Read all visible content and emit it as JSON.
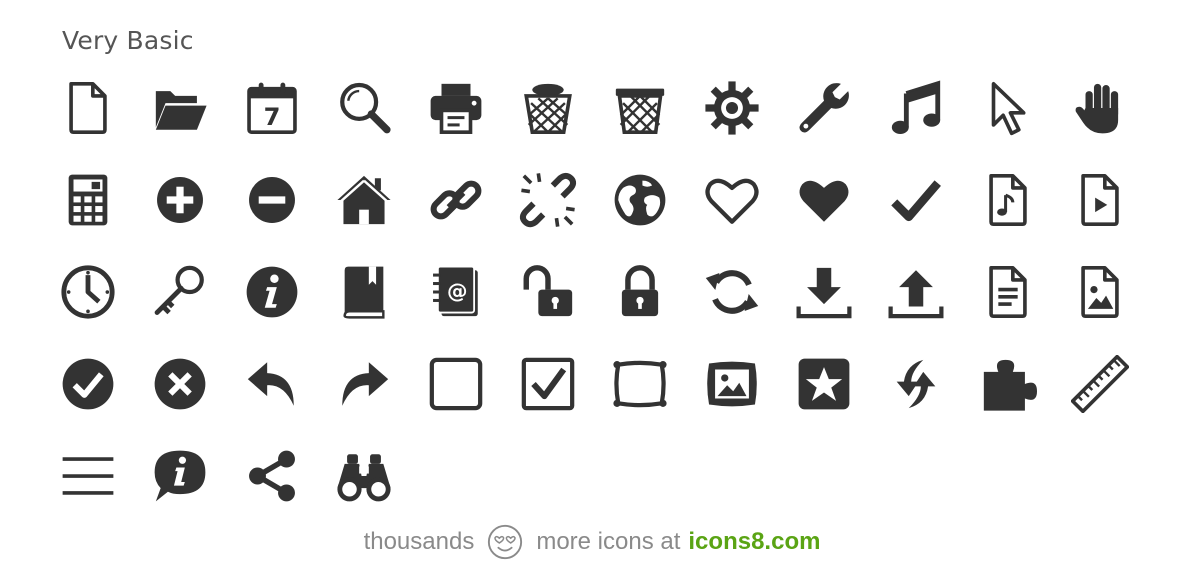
{
  "title": "Very Basic",
  "icons": [
    "document-icon",
    "folder-open-icon",
    "calendar-icon",
    "search-icon",
    "printer-icon",
    "trash-icon",
    "trash-empty-icon",
    "gear-icon",
    "wrench-icon",
    "music-note-icon",
    "cursor-icon",
    "hand-icon",
    "calculator-icon",
    "plus-circle-icon",
    "minus-circle-icon",
    "home-icon",
    "link-icon",
    "unlink-icon",
    "globe-icon",
    "heart-outline-icon",
    "heart-icon",
    "checkmark-icon",
    "audio-file-icon",
    "video-file-icon",
    "clock-icon",
    "key-icon",
    "info-icon",
    "book-icon",
    "address-book-icon",
    "lock-open-icon",
    "lock-icon",
    "refresh-icon",
    "download-icon",
    "upload-icon",
    "text-file-icon",
    "image-file-icon",
    "check-circle-icon",
    "close-circle-icon",
    "reply-icon",
    "forward-icon",
    "checkbox-empty-icon",
    "checkbox-checked-icon",
    "picture-frame-icon",
    "framed-picture-icon",
    "star-square-icon",
    "sync-arrows-icon",
    "puzzle-icon",
    "ruler-icon",
    "menu-icon",
    "info-bubble-icon",
    "share-icon",
    "binoculars-icon"
  ],
  "calendar_day": "7",
  "footer": {
    "prefix": "thousands",
    "middle": "more icons at",
    "brand": "icons8.com",
    "logo_icon": "heart-eyes-smiley-icon"
  },
  "colors": {
    "icon": "#333333",
    "title": "#555555",
    "footer_text": "#8a8a8a",
    "brand": "#5aa414"
  }
}
